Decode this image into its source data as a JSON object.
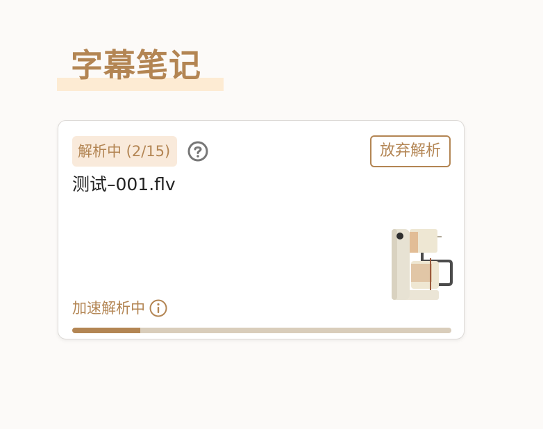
{
  "page": {
    "title": "字幕笔记"
  },
  "task_card": {
    "status_label": "解析中 (2/15)",
    "abandon_button_label": "放弃解析",
    "file_name": "测试–001.flv",
    "speed_label": "加速解析中",
    "progress_fraction": 0.18,
    "help_icon": "question-circle-icon",
    "info_icon": "info-circle-icon",
    "illustration": "coffee-machine-illustration"
  },
  "colors": {
    "accent": "#b38553",
    "badge_bg": "#f9eadb",
    "title_highlight": "#fdebd3",
    "progress_track": "#d9cdbb",
    "page_bg": "#fcfaf8"
  }
}
